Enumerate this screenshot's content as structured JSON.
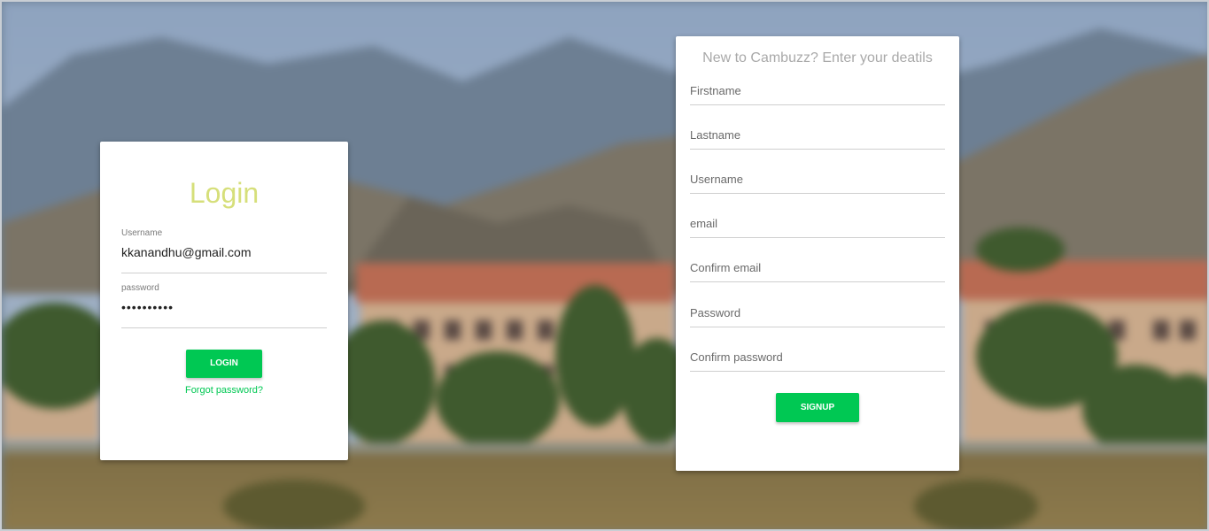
{
  "login": {
    "title": "Login",
    "username_label": "Username",
    "username_value": "kkanandhu@gmail.com",
    "password_label": "password",
    "password_value": "••••••••••",
    "login_button": "LOGIN",
    "forgot_link": "Forgot password?"
  },
  "signup": {
    "title": "New to Cambuzz? Enter your deatils",
    "fields": [
      {
        "placeholder": "Firstname"
      },
      {
        "placeholder": "Lastname"
      },
      {
        "placeholder": "Username"
      },
      {
        "placeholder": "email"
      },
      {
        "placeholder": "Confirm email"
      },
      {
        "placeholder": "Password"
      },
      {
        "placeholder": "Confirm password"
      }
    ],
    "signup_button": "SIGNUP"
  },
  "colors": {
    "accent": "#00c853",
    "login_title": "#d6df7a",
    "signup_title": "#a9a9a9"
  }
}
